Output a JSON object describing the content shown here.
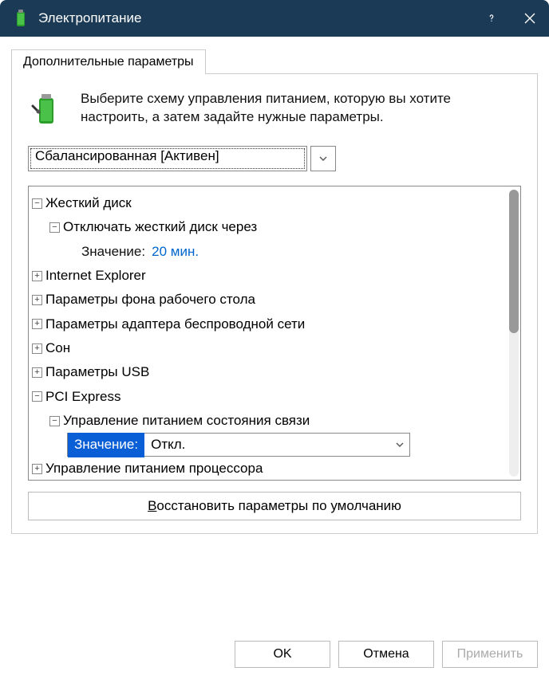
{
  "title": "Электропитание",
  "tab": "Дополнительные параметры",
  "intro": "Выберите схему управления питанием, которую вы хотите настроить, а затем задайте нужные параметры.",
  "plan": "Сбалансированная [Активен]",
  "tree": {
    "hdd": {
      "label": "Жесткий диск",
      "child": "Отключать жесткий диск через",
      "valueLabel": "Значение:",
      "value": "20 мин."
    },
    "ie": "Internet Explorer",
    "desktop": "Параметры фона рабочего стола",
    "wifi": "Параметры адаптера беспроводной сети",
    "sleep": "Сон",
    "usb": "Параметры USB",
    "pci": {
      "label": "PCI Express",
      "child": "Управление питанием состояния связи",
      "valueLabel": "Значение:",
      "value": "Откл."
    },
    "cpu": "Управление питанием процессора"
  },
  "restore": {
    "prefix": "В",
    "rest": "осстановить параметры по умолчанию"
  },
  "footer": {
    "ok": "OK",
    "cancel": "Отмена",
    "apply": "Применить"
  }
}
